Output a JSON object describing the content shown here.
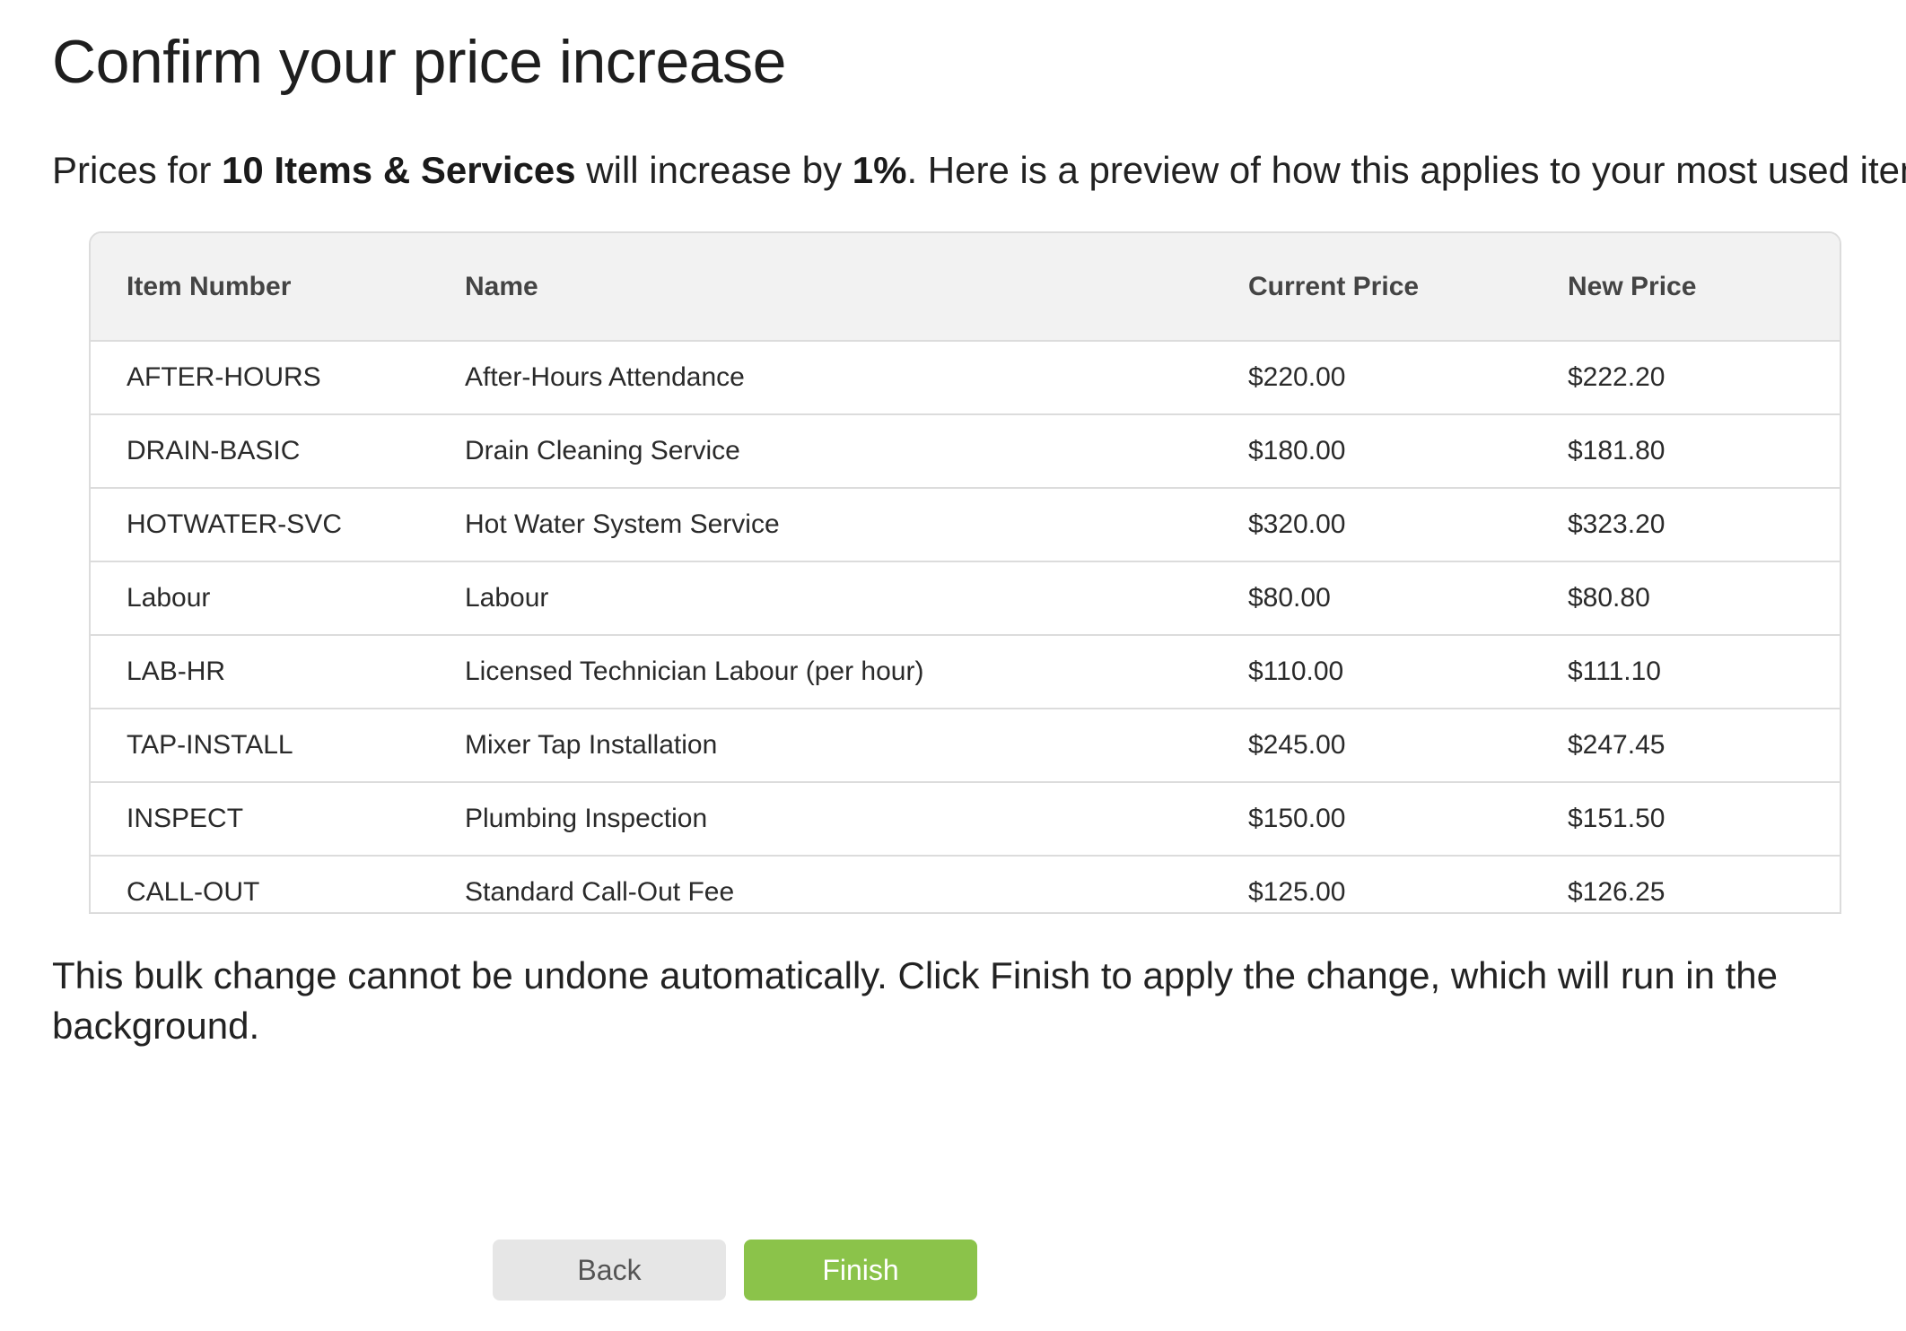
{
  "page": {
    "title": "Confirm your price increase"
  },
  "intro": {
    "prefix": "Prices for ",
    "item_count": "10 Items & Services",
    "middle": " will increase by ",
    "percent": "1%",
    "suffix": ". Here is a preview of how this applies to your most used items:"
  },
  "table": {
    "headers": {
      "item_number": "Item Number",
      "name": "Name",
      "current_price": "Current Price",
      "new_price": "New Price"
    },
    "rows": [
      {
        "item_number": "AFTER-HOURS",
        "name": "After-Hours Attendance",
        "current_price": "$220.00",
        "new_price": "$222.20"
      },
      {
        "item_number": "DRAIN-BASIC",
        "name": "Drain Cleaning Service",
        "current_price": "$180.00",
        "new_price": "$181.80"
      },
      {
        "item_number": "HOTWATER-SVC",
        "name": "Hot Water System Service",
        "current_price": "$320.00",
        "new_price": "$323.20"
      },
      {
        "item_number": "Labour",
        "name": "Labour",
        "current_price": "$80.00",
        "new_price": "$80.80"
      },
      {
        "item_number": "LAB-HR",
        "name": "Licensed Technician Labour (per hour)",
        "current_price": "$110.00",
        "new_price": "$111.10"
      },
      {
        "item_number": "TAP-INSTALL",
        "name": "Mixer Tap Installation",
        "current_price": "$245.00",
        "new_price": "$247.45"
      },
      {
        "item_number": "INSPECT",
        "name": "Plumbing Inspection",
        "current_price": "$150.00",
        "new_price": "$151.50"
      },
      {
        "item_number": "CALL-OUT",
        "name": "Standard Call-Out Fee",
        "current_price": "$125.00",
        "new_price": "$126.25"
      }
    ]
  },
  "note": "This bulk change cannot be undone automatically. Click Finish to apply the change, which will run in the background.",
  "buttons": {
    "back_label": "Back",
    "finish_label": "Finish"
  },
  "colors": {
    "finish_button": "#8bc34a",
    "back_button": "#e6e6e6",
    "table_header_bg": "#f2f2f2",
    "border": "#dcdcdc"
  }
}
